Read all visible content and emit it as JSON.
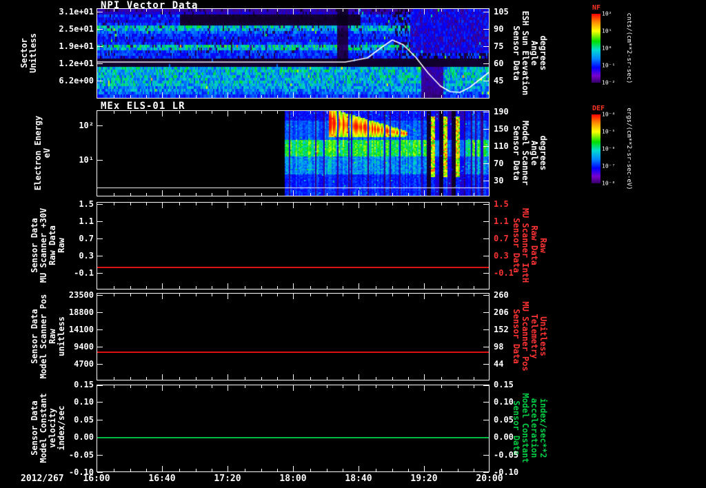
{
  "chart_data": {
    "type": "multi-panel time-series (tplot-style spacecraft data display)",
    "date": "2012/267",
    "x_ticks": [
      "16:00",
      "16:40",
      "17:20",
      "18:00",
      "18:40",
      "19:20",
      "20:00"
    ],
    "x_range": [
      "16:00",
      "20:00"
    ],
    "panels": [
      {
        "type": "spectrogram",
        "title": "NPI Vector Data",
        "left_label": "Sector\nUnitless",
        "left_ticks": [
          "3.1e+01",
          "2.5e+01",
          "1.9e+01",
          "1.2e+01",
          "6.2e+00"
        ],
        "right_label": "Sensor Data\nESH Sun Elevation\nAngle\ndegrees",
        "right_label_color": "#ffffff",
        "right_ticks": [
          "105",
          "90",
          "75",
          "60",
          "45"
        ],
        "colorbar": "NF",
        "description": "32 azimuth sectors of blue/cyan banded counts with black dropout band near sector 12; white overlay line (sun elevation) flat ~62 deg until ~18:40, peaks ~78 near 19:00, dips ~43 near 19:30, recovers toward 20:00"
      },
      {
        "type": "spectrogram",
        "title": "MEx ELS-01 LR",
        "left_label": "Electron Energy\neV",
        "left_ticks": [
          "10²",
          "10¹"
        ],
        "right_label": "Sensor Data\nModel Scanner\nAngle\ndegrees",
        "right_label_color": "#ffffff",
        "right_ticks": [
          "190",
          "150",
          "110",
          "70",
          "30"
        ],
        "colorbar": "DEF",
        "description": "no data before ~17:55; intense red electron flux 30-100 eV from ~18:25 decaying to ~19:00; green band 10-30 eV; vertical dropout stripes ~19:20-19:40; flat white trace near panel bottom"
      },
      {
        "type": "line",
        "left_label": "Sensor Data\nMU Scanner +30V\nRaw Data\nRaw",
        "left_ticks": [
          "1.5",
          "1.1",
          "0.7",
          "0.3",
          "-0.1"
        ],
        "right_label": "Sensor Data\nMU Scanner IntH\nRaw Data\nRaw",
        "right_label_color": "#ff3333",
        "right_ticks": [
          "1.5",
          "1.1",
          "0.7",
          "0.3",
          "-0.1"
        ],
        "right_tick_color": "#ff3333",
        "line_color": "#dd1111",
        "line_value": 0.05,
        "description": "constant ~0.05 across entire interval"
      },
      {
        "type": "line",
        "left_label": "Sensor Data\nModel Scanner Pos\nRaw\nunitless",
        "left_ticks": [
          "23500",
          "18800",
          "14100",
          "9400",
          "4700"
        ],
        "right_label": "Sensor Data\nMU Scanner Pos\nTelemetry\nUnitless",
        "right_label_color": "#ff3333",
        "right_ticks": [
          "260",
          "206",
          "152",
          "98",
          "44"
        ],
        "right_tick_color": "#ffffff",
        "line_color": "#dd1111",
        "line_value": 8100,
        "description": "constant ~8100 across entire interval"
      },
      {
        "type": "line",
        "left_label": "Sensor Data\nModel Constant\nvelocity\nindex/sec",
        "left_ticks": [
          "0.15",
          "0.10",
          "0.05",
          "0.00",
          "-0.05",
          "-0.10"
        ],
        "right_label": "Sensor Data\nModel Constant\nacceleration\nindex/sec**2",
        "right_label_color": "#00cc44",
        "right_ticks": [
          "0.15",
          "0.10",
          "0.05",
          "0.00",
          "-0.05",
          "-0.10"
        ],
        "right_tick_color": "#ffffff",
        "line_color": "#00bb44",
        "line_value": 0.0,
        "description": "constant 0.00 across entire interval"
      }
    ],
    "colorbars": [
      {
        "title": "NF",
        "ticks": [
          "10²",
          "10¹",
          "10⁰",
          "10⁻¹",
          "10⁻²"
        ],
        "unit": "cnts/(cm**2-sr-sec)"
      },
      {
        "title": "DEF",
        "ticks": [
          "10⁻⁴",
          "10⁻⁵",
          "10⁻⁶",
          "10⁻⁷",
          "10⁻⁸"
        ],
        "unit": "ergs/(cm**2-sr-sec-eV)"
      }
    ]
  }
}
